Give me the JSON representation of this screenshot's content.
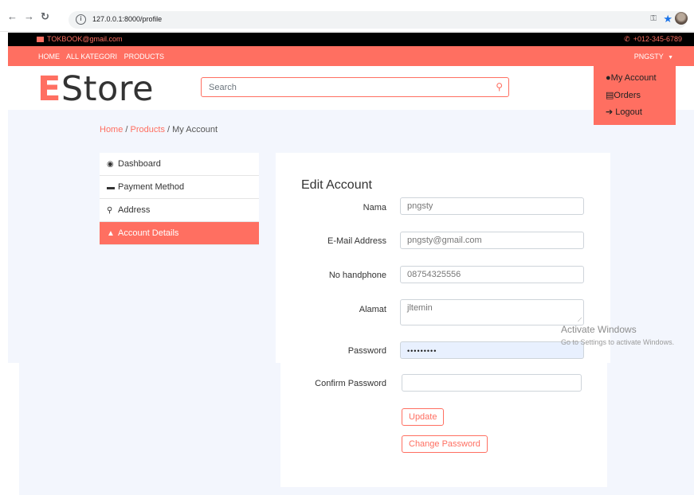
{
  "browser": {
    "url": "127.0.0.1:8000/profile",
    "back": "←",
    "forward": "→",
    "reload": "↻"
  },
  "topbar": {
    "email": "TOKBOOK@gmail.com",
    "phone": "+012-345-6789"
  },
  "nav": {
    "links": [
      "HOME",
      "ALL KATEGORI",
      "PRODUCTS"
    ],
    "user": "PNGSTY"
  },
  "logo": {
    "first": "E",
    "rest": "Store"
  },
  "search": {
    "placeholder": "Search"
  },
  "dropdown": {
    "items": [
      "My Account",
      "Orders",
      "Logout"
    ]
  },
  "breadcrumb": {
    "home": "Home",
    "products": "Products",
    "current": "My Account"
  },
  "sidebar": {
    "items": [
      {
        "label": "Dashboard",
        "icon": "tachometer-icon"
      },
      {
        "label": "Payment Method",
        "icon": "credit-card-icon"
      },
      {
        "label": "Address",
        "icon": "map-marker-icon"
      },
      {
        "label": "Account Details",
        "icon": "user-icon",
        "active": true
      }
    ]
  },
  "form": {
    "title": "Edit Account",
    "nama_label": "Nama",
    "nama_value": "pngsty",
    "email_label": "E-Mail Address",
    "email_value": "pngsty@gmail.com",
    "phone_label": "No handphone",
    "phone_value": "08754325556",
    "alamat_label": "Alamat",
    "alamat_value": "jltemin",
    "password_label": "Password",
    "password_value": "•••••••••",
    "confirm_label": "Confirm Password",
    "confirm_value": "",
    "update_label": "Update",
    "change_password_label": "Change Password"
  },
  "watermark": {
    "line1": "Activate Windows",
    "line2": "Go to Settings to activate Windows."
  },
  "colors": {
    "accent": "#ff6f61",
    "page_bg": "#f3f6fd"
  }
}
